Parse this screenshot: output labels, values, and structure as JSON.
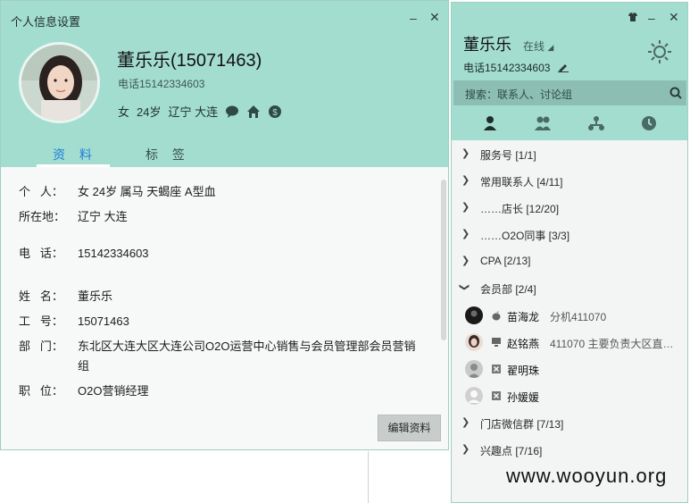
{
  "profile_window": {
    "title": "个人信息设置",
    "name": "董乐乐(15071463)",
    "phone": "电话15142334603",
    "meta": {
      "gender": "女",
      "age": "24岁",
      "location": "辽宁 大连"
    },
    "tabs": [
      {
        "label": "资 料",
        "active": true
      },
      {
        "label": "标 签",
        "active": false
      }
    ],
    "fields": [
      {
        "label": "个   人：",
        "value": "女  24岁  属马  天蝎座  A型血"
      },
      {
        "label": "所在地：",
        "value": "辽宁 大连"
      },
      {
        "label": "电   话：",
        "value": "15142334603"
      },
      {
        "label": "姓   名：",
        "value": "董乐乐"
      },
      {
        "label": "工   号：",
        "value": "15071463"
      },
      {
        "label": "部   门：",
        "value": "东北区大连大区大连公司O2O运营中心销售与会员管理部会员营销组"
      },
      {
        "label": "职   位：",
        "value": "O2O营销经理"
      }
    ],
    "edit_button": "编辑资料"
  },
  "contacts_window": {
    "user_name": "董乐乐",
    "status": "在线",
    "phone": "电话15142334603",
    "search_placeholder": "搜索：联系人、讨论组",
    "tabs": [
      "contact-icon",
      "group-icon",
      "org-icon",
      "recent-icon"
    ],
    "groups_top": [
      {
        "label": "服务号 [1/1]"
      },
      {
        "label": "常用联系人 [4/11]"
      },
      {
        "label": "……店长 [12/20]"
      },
      {
        "label": "……O2O同事 [3/3]"
      },
      {
        "label": "CPA [2/13]"
      },
      {
        "label": "会员部 [2/4]",
        "expanded": true
      }
    ],
    "members": [
      {
        "name": "苗海龙",
        "signature": "分机411070",
        "device": "apple-icon"
      },
      {
        "name": "赵铭燕",
        "signature": "411070 主要负责大区直…",
        "device": "monitor-icon"
      },
      {
        "name": "翟明珠",
        "signature": "",
        "device": "offline-icon"
      },
      {
        "name": "孙媛媛",
        "signature": "",
        "device": "offline-icon"
      }
    ],
    "groups_bottom": [
      {
        "label": "门店微信群 [7/13]"
      },
      {
        "label": "兴趣点 [7/16]"
      }
    ]
  },
  "watermark": "www.wooyun.org",
  "colors": {
    "header": "#a3ddd0",
    "tab_active": "#1d7fd7",
    "panel_bg": "#f7f8f8"
  }
}
